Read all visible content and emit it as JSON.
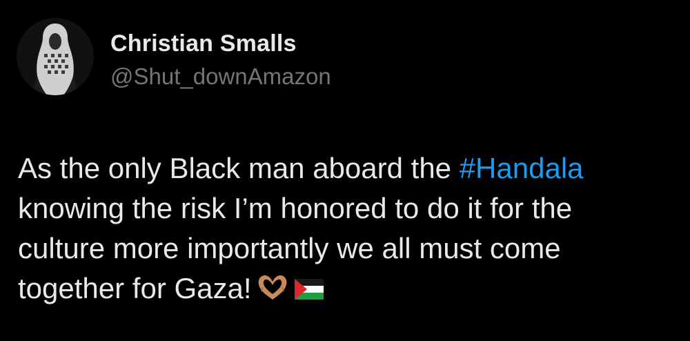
{
  "author": {
    "display_name": "Christian Smalls",
    "handle": "@Shut_downAmazon",
    "avatar_icon": "profile-photo-icon"
  },
  "tweet": {
    "line1_text": "As the only Black man aboard the ",
    "hashtag": "#Handala",
    "line2_text": "knowing the risk I’m honored to do it for the",
    "line3_text": "culture more importantly we all must come",
    "line4_text": "together for Gaza!",
    "emojis": [
      "heart-hands-emoji",
      "palestine-flag-emoji"
    ]
  },
  "colors": {
    "background": "#000000",
    "primary_text": "#e7e9ea",
    "secondary_text": "#71767b",
    "link": "#1d9bf0"
  }
}
